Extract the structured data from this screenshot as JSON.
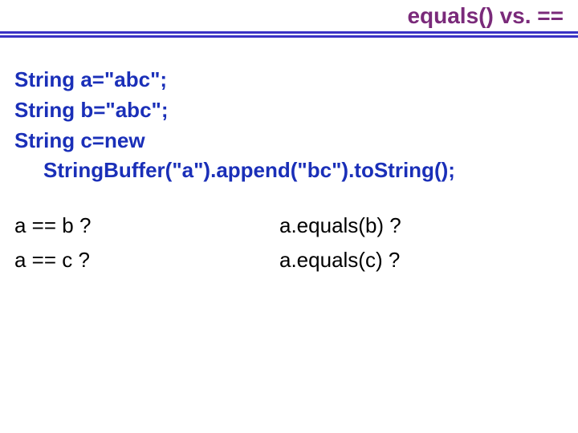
{
  "title": "equals() vs. ==",
  "code": {
    "line1": "String a=\"abc\";",
    "line2": "String b=\"abc\";",
    "line3": "String c=new",
    "line3b": "StringBuffer(\"a\").append(\"bc\").toString();"
  },
  "questions": {
    "r1": {
      "left": "a == b ?",
      "right": "a.equals(b) ?"
    },
    "r2": {
      "left": "a == c ?",
      "right": "a.equals(c) ?"
    }
  }
}
